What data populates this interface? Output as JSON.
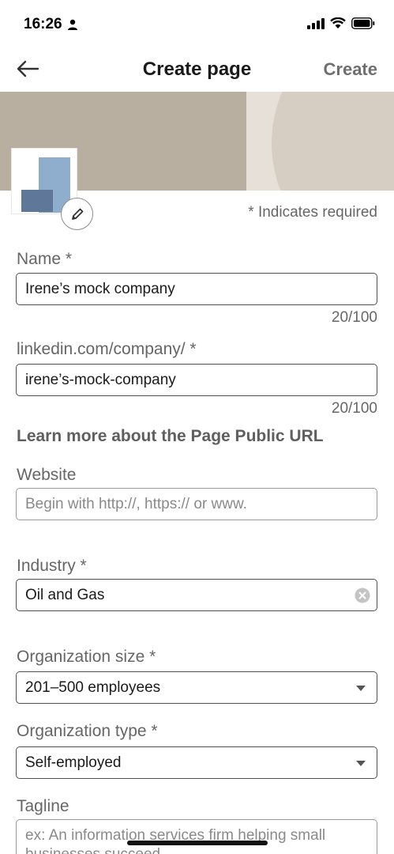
{
  "status_bar": {
    "time": "16:26"
  },
  "nav": {
    "title": "Create page",
    "create_label": "Create"
  },
  "required_note": "* Indicates required",
  "form": {
    "name": {
      "label": "Name *",
      "value": "Irene’s mock company",
      "counter": "20/100"
    },
    "url": {
      "label": "linkedin.com/company/ *",
      "value": "irene’s-mock-company",
      "counter": "20/100"
    },
    "learn_more": "Learn more about the Page Public URL",
    "website": {
      "label": "Website",
      "placeholder": "Begin with http://, https:// or www."
    },
    "industry": {
      "label": "Industry *",
      "value": "Oil and Gas"
    },
    "org_size": {
      "label": "Organization size *",
      "value": "201–500 employees"
    },
    "org_type": {
      "label": "Organization type *",
      "value": "Self-employed"
    },
    "tagline": {
      "label": "Tagline",
      "placeholder": "ex: An information services firm helping small businesses succeed."
    }
  },
  "icons": {
    "back": "back-arrow-icon",
    "edit": "pencil-icon",
    "clear": "clear-icon",
    "dropdown": "chevron-down-icon"
  }
}
